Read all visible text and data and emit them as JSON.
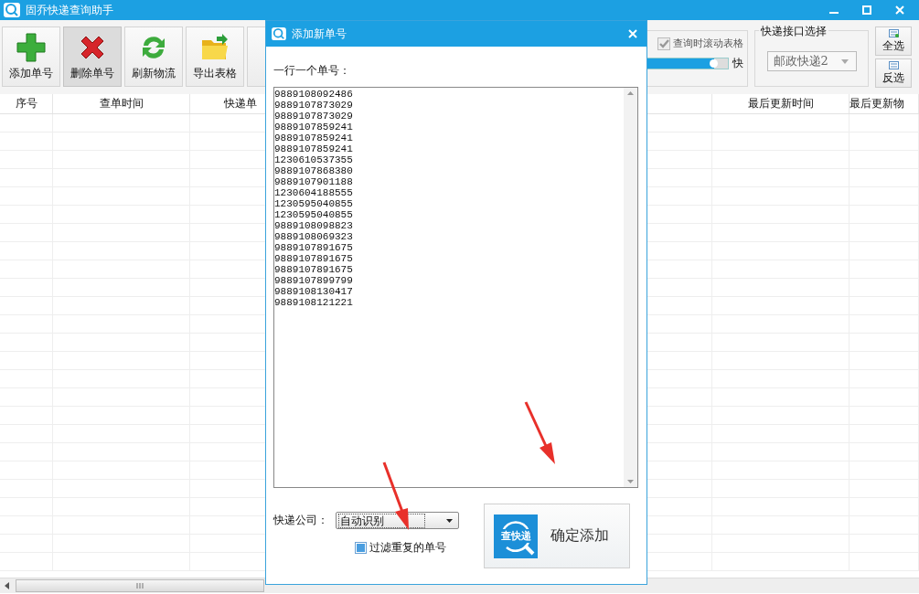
{
  "window": {
    "title": "固乔快递查询助手"
  },
  "toolbar": {
    "buttons": [
      {
        "label": "添加单号",
        "kind": "add",
        "selected": false
      },
      {
        "label": "删除单号",
        "kind": "delete",
        "selected": true
      },
      {
        "label": "刷新物流",
        "kind": "refresh",
        "selected": false
      },
      {
        "label": "导出表格",
        "kind": "export",
        "selected": false
      }
    ]
  },
  "scroll_option": {
    "label": "查询时滚动表格",
    "checked": true,
    "level": 0.85,
    "speed_label": "快"
  },
  "api_group": {
    "title": "快递接口选择",
    "value": "邮政快递2"
  },
  "selection_buttons": [
    "全选",
    "反选"
  ],
  "table": {
    "columns": [
      "序号",
      "查单时间",
      "快递单",
      "最后更新时间",
      "最后更新物"
    ]
  },
  "dialog": {
    "title": "添加新单号",
    "input_label": "一行一个单号：",
    "numbers": [
      "9889108092486",
      "9889107873029",
      "9889107873029",
      "9889107859241",
      "9889107859241",
      "9889107859241",
      "1230610537355",
      "9889107868380",
      "9889107901188",
      "1230604188555",
      "1230595040855",
      "1230595040855",
      "9889108098823",
      "9889108069323",
      "9889107891675",
      "9889107891675",
      "9889107891675",
      "9889107899799",
      "9889108130417",
      "9889108121221"
    ],
    "company_label": "快递公司：",
    "company_value": "自动识别",
    "filter": {
      "label": "过滤重复的单号",
      "checked": true
    },
    "confirm_button": {
      "badge": "查快递",
      "label": "确定添加"
    }
  }
}
